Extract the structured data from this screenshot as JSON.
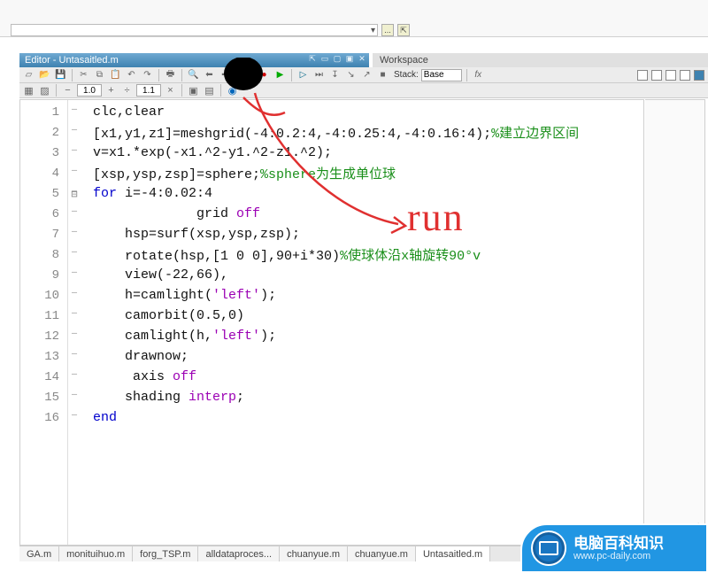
{
  "top": {
    "ellipsis": "...",
    "folder_up": "⇱"
  },
  "editor": {
    "title": "Editor - Untasaitled.m",
    "workspace": "Workspace"
  },
  "toolbar1": {
    "stack_label": "Stack:",
    "stack_value": "Base",
    "fx": "fx"
  },
  "toolbar2": {
    "zoom_a": "1.0",
    "zoom_b": "1.1"
  },
  "code": {
    "lines": [
      {
        "n": 1,
        "ind": 0,
        "segs": [
          {
            "t": "clc,clear"
          }
        ]
      },
      {
        "n": 2,
        "ind": 0,
        "segs": [
          {
            "t": "[x1,y1,z1]=meshgrid(-4:0.2:4,-4:0.25:4,-4:0.16:4);"
          },
          {
            "t": "%建立边界区间",
            "c": "cmt"
          }
        ]
      },
      {
        "n": 3,
        "ind": 0,
        "segs": [
          {
            "t": "v=x1.*exp(-x1.^2-y1.^2-z1.^2);"
          }
        ]
      },
      {
        "n": 4,
        "ind": 0,
        "segs": [
          {
            "t": "[xsp,ysp,zsp]=sphere;"
          },
          {
            "t": "%sphere为生成单位球",
            "c": "cmt"
          }
        ]
      },
      {
        "n": 5,
        "ind": 0,
        "fold": "⊟",
        "segs": [
          {
            "t": "for",
            "c": "kw"
          },
          {
            "t": " i=-4:0.02:4"
          }
        ]
      },
      {
        "n": 6,
        "ind": 2,
        "segs": [
          {
            "t": "     grid "
          },
          {
            "t": "off",
            "c": "str"
          }
        ]
      },
      {
        "n": 7,
        "ind": 1,
        "segs": [
          {
            "t": "hsp=surf(xsp,ysp,zsp);"
          }
        ]
      },
      {
        "n": 8,
        "ind": 1,
        "segs": [
          {
            "t": "rotate(hsp,[1 0 0],90+i*30)"
          },
          {
            "t": "%使球体沿x轴旋转90°v",
            "c": "cmt"
          }
        ]
      },
      {
        "n": 9,
        "ind": 1,
        "segs": [
          {
            "t": "view(-22,66),"
          }
        ]
      },
      {
        "n": 10,
        "ind": 1,
        "segs": [
          {
            "t": "h=camlight("
          },
          {
            "t": "'left'",
            "c": "str"
          },
          {
            "t": ");"
          }
        ]
      },
      {
        "n": 11,
        "ind": 1,
        "segs": [
          {
            "t": "camorbit(0.5,0)"
          }
        ]
      },
      {
        "n": 12,
        "ind": 1,
        "segs": [
          {
            "t": "camlight(h,"
          },
          {
            "t": "'left'",
            "c": "str"
          },
          {
            "t": ");"
          }
        ]
      },
      {
        "n": 13,
        "ind": 1,
        "segs": [
          {
            "t": "drawnow;"
          }
        ]
      },
      {
        "n": 14,
        "ind": 1,
        "segs": [
          {
            "t": " axis "
          },
          {
            "t": "off",
            "c": "str"
          }
        ]
      },
      {
        "n": 15,
        "ind": 1,
        "segs": [
          {
            "t": "shading "
          },
          {
            "t": "interp",
            "c": "str"
          },
          {
            "t": ";"
          }
        ]
      },
      {
        "n": 16,
        "ind": 0,
        "segs": [
          {
            "t": "end",
            "c": "kw"
          }
        ]
      }
    ]
  },
  "tabs": [
    {
      "label": "GA.m"
    },
    {
      "label": "monituihuo.m"
    },
    {
      "label": "forg_TSP.m"
    },
    {
      "label": "alldataproces..."
    },
    {
      "label": "chuanyue.m"
    },
    {
      "label": "chuanyue.m"
    },
    {
      "label": "Untasaitled.m",
      "active": true
    }
  ],
  "brand": {
    "text": "电脑百科知识",
    "url": "www.pc-daily.com"
  },
  "annotation_label": "run"
}
